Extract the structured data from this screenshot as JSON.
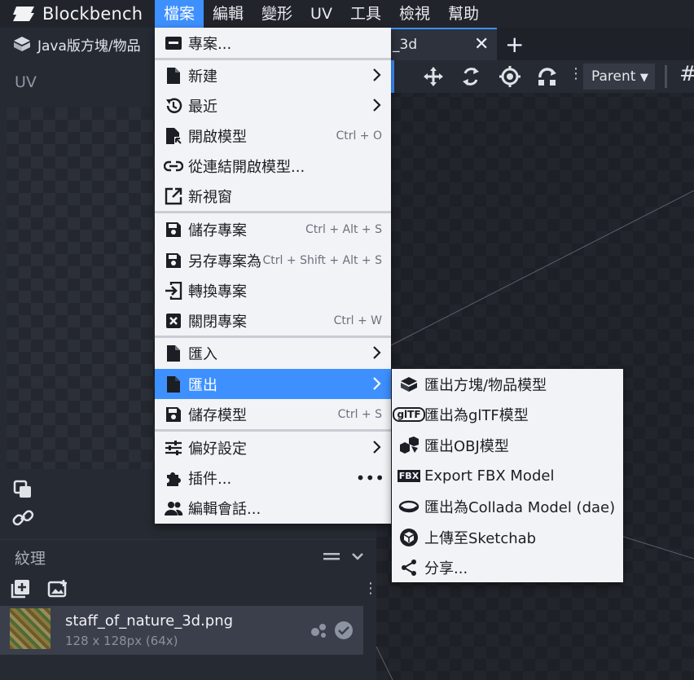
{
  "app": {
    "name": "Blockbench"
  },
  "menubar": [
    "檔案",
    "編輯",
    "變形",
    "UV",
    "工具",
    "檢視",
    "幫助"
  ],
  "tabs": {
    "left": "Java版方塊/物品",
    "right": "_3d"
  },
  "uv_panel": {
    "title": "UV"
  },
  "texture_panel": {
    "title": "紋理",
    "texture": {
      "name": "staff_of_nature_3d.png",
      "size": "128 x 128px (64x)"
    }
  },
  "viewport": {
    "parent_select": "Parent"
  },
  "file_menu": {
    "items": [
      {
        "label": "專案...",
        "shortcut": ""
      },
      {
        "label": "新建",
        "shortcut": ""
      },
      {
        "label": "最近",
        "shortcut": ""
      },
      {
        "label": "開啟模型",
        "shortcut": "Ctrl + O"
      },
      {
        "label": "從連結開啟模型...",
        "shortcut": ""
      },
      {
        "label": "新視窗",
        "shortcut": ""
      },
      {
        "label": "儲存專案",
        "shortcut": "Ctrl + Alt + S"
      },
      {
        "label": "另存專案為",
        "shortcut": "Ctrl + Shift + Alt + S"
      },
      {
        "label": "轉換專案",
        "shortcut": ""
      },
      {
        "label": "關閉專案",
        "shortcut": "Ctrl + W"
      },
      {
        "label": "匯入",
        "shortcut": ""
      },
      {
        "label": "匯出",
        "shortcut": ""
      },
      {
        "label": "儲存模型",
        "shortcut": "Ctrl + S"
      },
      {
        "label": "偏好設定",
        "shortcut": ""
      },
      {
        "label": "插件...",
        "shortcut": ""
      },
      {
        "label": "編輯會話...",
        "shortcut": ""
      }
    ]
  },
  "export_submenu": {
    "items": [
      {
        "label": "匯出方塊/物品模型"
      },
      {
        "label": "匯出為glTF模型",
        "icon_text": "glTF"
      },
      {
        "label": "匯出OBJ模型"
      },
      {
        "label": "Export FBX Model",
        "icon_text": "FBX"
      },
      {
        "label": "匯出為Collada Model (dae)"
      },
      {
        "label": "上傳至Sketchab"
      },
      {
        "label": "分享..."
      }
    ]
  },
  "colors": {
    "accent": "#3e90ff",
    "menu_bg": "#f2f3f6",
    "panel_bg": "#262a32"
  }
}
